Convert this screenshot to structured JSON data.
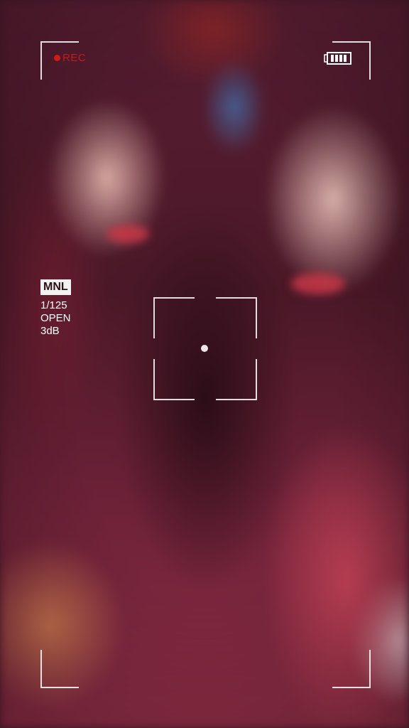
{
  "viewfinder": {
    "rec_label": "REC",
    "rec_color": "#c41c1c",
    "mode_badge": "MNL",
    "shutter_speed": "1/125",
    "aperture": "OPEN",
    "gain": "3dB",
    "battery_level": 1.0
  },
  "icons": {
    "battery": "battery-icon",
    "rec": "record-dot-icon",
    "focus": "focus-reticle-icon"
  }
}
